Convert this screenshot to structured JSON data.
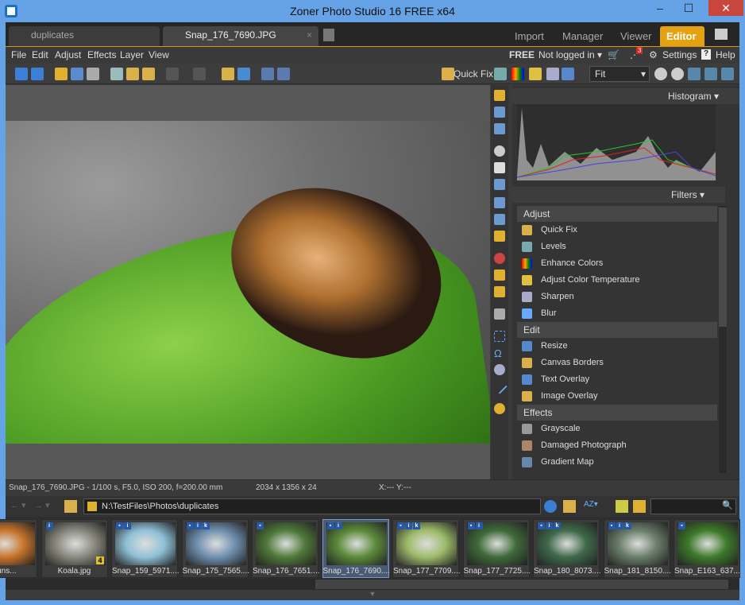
{
  "window": {
    "title": "Zoner Photo Studio 16 FREE x64",
    "minimize": "‒",
    "maximize": "☐",
    "close": "✕"
  },
  "tabs": [
    {
      "label": "duplicates",
      "active": false
    },
    {
      "label": "Snap_176_7690.JPG",
      "active": true,
      "close": "×"
    }
  ],
  "modes": [
    {
      "label": "Import"
    },
    {
      "label": "Manager"
    },
    {
      "label": "Viewer"
    },
    {
      "label": "Editor",
      "active": true
    }
  ],
  "menu": [
    "File",
    "Edit",
    "Adjust",
    "Effects",
    "Layer",
    "View"
  ],
  "account": {
    "edition": "FREE",
    "login": "Not logged in ▾",
    "notifications": "3",
    "settings": "Settings",
    "help": "Help"
  },
  "toolbar": {
    "quick_fix": "Quick Fix",
    "zoom_value": "Fit"
  },
  "panel": {
    "histogram": "Histogram ▾",
    "filters": "Filters ▾",
    "sections": [
      {
        "title": "Adjust",
        "items": [
          {
            "label": "Quick Fix",
            "icon": "quick-fix-icon"
          },
          {
            "label": "Levels",
            "icon": "levels-icon"
          },
          {
            "label": "Enhance Colors",
            "icon": "rainbow-icon"
          },
          {
            "label": "Adjust Color Temperature",
            "icon": "temperature-icon"
          },
          {
            "label": "Sharpen",
            "icon": "sharpen-icon"
          },
          {
            "label": "Blur",
            "icon": "blur-icon"
          }
        ]
      },
      {
        "title": "Edit",
        "items": [
          {
            "label": "Resize",
            "icon": "resize-icon"
          },
          {
            "label": "Canvas  Borders",
            "icon": "canvas-icon"
          },
          {
            "label": "Text Overlay",
            "icon": "text-icon"
          },
          {
            "label": "Image Overlay",
            "icon": "image-overlay-icon"
          }
        ]
      },
      {
        "title": "Effects",
        "items": [
          {
            "label": "Grayscale",
            "icon": "grayscale-icon"
          },
          {
            "label": "Damaged Photograph",
            "icon": "damaged-icon"
          },
          {
            "label": "Gradient Map",
            "icon": "gradient-map-icon"
          }
        ]
      }
    ]
  },
  "status": {
    "exif": "Snap_176_7690.JPG - 1/100 s, F5.0, ISO 200, f=200.00 mm",
    "dimensions": "2034 x 1356 x 24",
    "coords": "X:---  Y:---"
  },
  "browser": {
    "path": "N:\\TestFiles\\Photos\\duplicates",
    "search_placeholder": ""
  },
  "thumbnails": [
    {
      "label": "Suns...",
      "badges": [],
      "color": "#c8742a"
    },
    {
      "label": "Koala.jpg",
      "badges": [
        "i"
      ],
      "color": "#8a8a80",
      "count": "4"
    },
    {
      "label": "Snap_159_5971....",
      "badges": [
        "▪",
        "i"
      ],
      "color": "#8fc1d6"
    },
    {
      "label": "Snap_175_7565....",
      "badges": [
        "▪",
        "i",
        "k"
      ],
      "color": "#6f8fae"
    },
    {
      "label": "Snap_176_7651....",
      "badges": [
        "▪"
      ],
      "color": "#4f7a3a"
    },
    {
      "label": "Snap_176_7690....",
      "badges": [
        "▪",
        "i"
      ],
      "color": "#5c8a3a",
      "selected": true
    },
    {
      "label": "Snap_177_7709....",
      "badges": [
        "▪",
        "i",
        "k"
      ],
      "color": "#9dbb6a"
    },
    {
      "label": "Snap_177_7725....",
      "badges": [
        "▪",
        "i"
      ],
      "color": "#3f6a3a"
    },
    {
      "label": "Snap_180_8073....",
      "badges": [
        "▪",
        "i",
        "k"
      ],
      "color": "#3f6a4a"
    },
    {
      "label": "Snap_181_8150....",
      "badges": [
        "▪",
        "i",
        "k"
      ],
      "color": "#6a7e6a"
    },
    {
      "label": "Snap_E163_637...",
      "badges": [
        "▪"
      ],
      "color": "#3d7a2a"
    }
  ]
}
